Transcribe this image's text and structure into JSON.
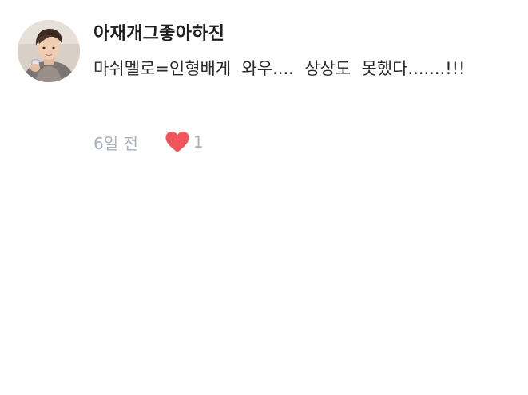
{
  "comment": {
    "username": "아재개그좋아하진",
    "text": "마쉬멜로=인형배게  와우....  상상도  못했다.......!!!",
    "timestamp": "6일 전",
    "like": {
      "icon": "heart-icon",
      "count": "1",
      "color": "#f2545b"
    },
    "avatar": {
      "icon": "avatar"
    }
  },
  "colors": {
    "username": "#1f1f1f",
    "text": "#2a2a2a",
    "meta": "#a9b1bd",
    "background": "#ffffff",
    "heart": "#f2545b"
  }
}
